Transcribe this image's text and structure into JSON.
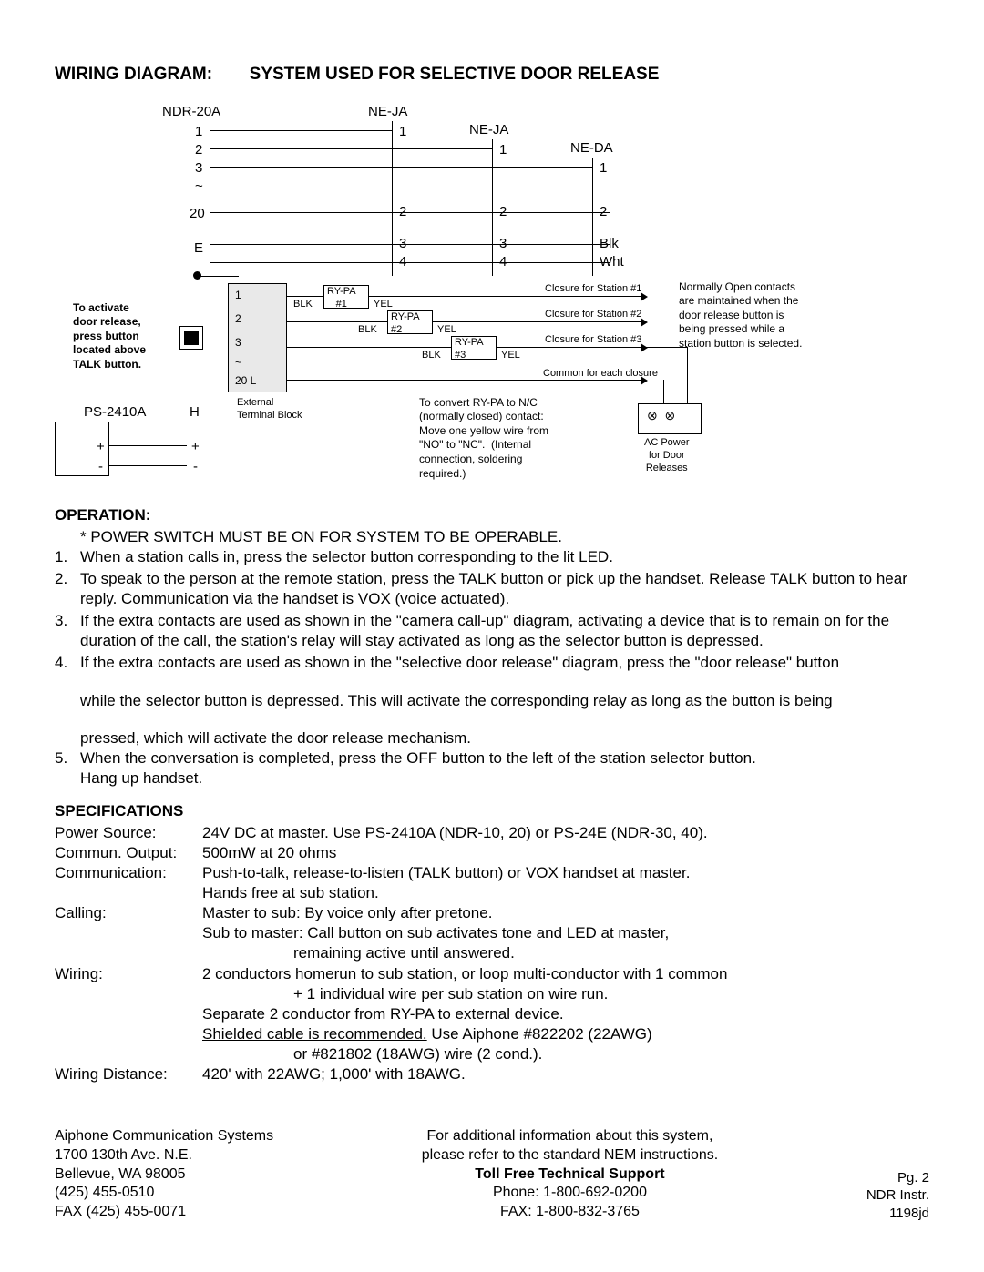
{
  "title_left": "WIRING DIAGRAM:",
  "title_right": "SYSTEM USED FOR SELECTIVE DOOR RELEASE",
  "diagram": {
    "ndr": "NDR-20A",
    "neja1": "NE-JA",
    "neja2": "NE-JA",
    "neda": "NE-DA",
    "ndr_terms": [
      "1",
      "2",
      "3",
      "~",
      "20",
      "E"
    ],
    "ndr_terms2": [
      "1",
      "2",
      "3",
      "~",
      "20  L"
    ],
    "h": "H",
    "plus": "+",
    "minus": "-",
    "ps": "PS-2410A",
    "activate_note": "To activate\ndoor release,\npress button\nlocated above\nTALK button.",
    "ext_block": "External\nTerminal Block",
    "rypa1": "RY-PA\n#1",
    "rypa2": "RY-PA\n#2",
    "rypa3": "RY-PA\n#3",
    "blk": "BLK",
    "yel": "YEL",
    "cl1": "Closure for Station #1",
    "cl2": "Closure for Station #2",
    "cl3": "Closure for Station #3",
    "common": "Common for each closure",
    "convert_note": "To convert RY-PA to N/C\n(normally closed) contact:\nMove one yellow wire from\n\"NO\" to \"NC\".  (Internal\nconnection, soldering\nrequired.)",
    "nopen_note": "Normally Open contacts\nare maintained when the\ndoor release button is\nbeing pressed while a\nstation button is selected.",
    "acpower": "AC Power\nfor Door\nReleases",
    "col1_terms": [
      "1",
      "2",
      "3",
      "4"
    ],
    "col2_terms": [
      "1",
      "2",
      "3",
      "4"
    ],
    "col3_terms": [
      "1",
      "2",
      "Blk",
      "Wht"
    ]
  },
  "operation": {
    "heading": "OPERATION:",
    "star": "* POWER SWITCH MUST BE ON FOR SYSTEM TO BE OPERABLE.",
    "items": [
      {
        "n": "1.",
        "t": "When a station calls in, press the selector button corresponding to the lit LED."
      },
      {
        "n": "2.",
        "t": "To speak to the person at the remote station, press the TALK button or pick up the handset.  Release TALK button to hear reply.  Communication via the handset is VOX (voice actuated)."
      },
      {
        "n": "3.",
        "t": "If the extra contacts are used as shown in the \"camera call-up\" diagram, activating a device that is to remain on for the duration of the call, the station's relay will stay activated as long as the selector button is depressed."
      },
      {
        "n": "4.",
        "t": "If the extra contacts are used as shown in the \"selective door release\" diagram, press the \"door release\" button"
      },
      {
        "n": "",
        "t": "while the selector button is depressed.  This will activate the corresponding relay as long as the button is being"
      },
      {
        "n": "",
        "t": "pressed, which will activate the door release mechanism."
      },
      {
        "n": "5.",
        "t": "When the conversation is completed, press the OFF button to the left of the station selector button.\nHang up handset."
      }
    ]
  },
  "specs": {
    "heading": "SPECIFICATIONS",
    "rows": [
      {
        "k": "Power Source:",
        "v": "24V DC at master.  Use PS-2410A (NDR-10, 20) or PS-24E (NDR-30, 40)."
      },
      {
        "k": "Commun. Output:",
        "v": "500mW at 20 ohms"
      },
      {
        "k": "Communication:",
        "v": "Push-to-talk, release-to-listen (TALK button) or VOX handset at master."
      },
      {
        "k": "",
        "v": "Hands free at sub station."
      },
      {
        "k": "Calling:",
        "v": "Master to sub:  By voice only after pretone."
      },
      {
        "k": "",
        "v": "Sub to master:  Call button on sub activates tone and LED at master,"
      },
      {
        "k": "",
        "v": "",
        "sub": "remaining active until answered."
      },
      {
        "k": "Wiring:",
        "v": "2 conductors homerun to sub station, or loop multi-conductor with 1 common"
      },
      {
        "k": "",
        "v": "",
        "sub": "+ 1 individual wire per sub station on wire run."
      },
      {
        "k": "",
        "v": "Separate 2 conductor from RY-PA to external device."
      },
      {
        "k": "",
        "v": "",
        "under": "Shielded cable is recommended.",
        "tail": "  Use Aiphone #822202 (22AWG)"
      },
      {
        "k": "",
        "v": "",
        "sub": "or #821802 (18AWG) wire (2 cond.)."
      },
      {
        "k": "Wiring Distance:",
        "v": "420' with 22AWG; 1,000' with 18AWG."
      }
    ]
  },
  "footer": {
    "addr": [
      "Aiphone Communication Systems",
      "1700 130th Ave. N.E.",
      "Bellevue, WA  98005",
      "(425) 455-0510",
      "FAX (425) 455-0071"
    ],
    "mid": [
      "For additional information about this system,",
      "please refer to the standard NEM instructions.",
      "Toll Free Technical Support",
      "Phone: 1-800-692-0200",
      "FAX: 1-800-832-3765"
    ],
    "right": [
      "Pg. 2",
      "NDR Instr.",
      "1198jd"
    ]
  }
}
